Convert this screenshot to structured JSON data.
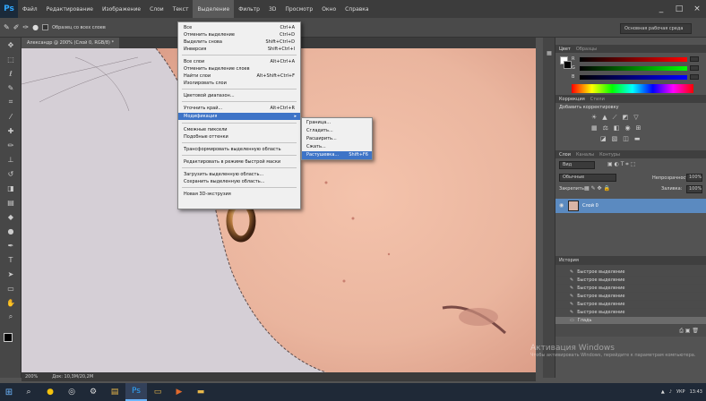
{
  "app": {
    "logo": "Ps",
    "menu": [
      "Файл",
      "Редактирование",
      "Изображение",
      "Слои",
      "Текст",
      "Выделение",
      "Фильтр",
      "3D",
      "Просмотр",
      "Окно",
      "Справка"
    ],
    "active_menu_index": 5
  },
  "window_controls": {
    "minimize": "_",
    "maximize": "□",
    "close": "×"
  },
  "options_bar": {
    "sample_all_layers": "Образец со всех слоев",
    "workspace": "Основная рабочая среда"
  },
  "document": {
    "tab_title": "Александр @ 200% (Слой 0, RGB/8) *",
    "zoom": "200%",
    "doc_size": "Док: 10,3M/20,2M"
  },
  "selection_menu": {
    "items": [
      {
        "label": "Все",
        "shortcut": "Ctrl+A"
      },
      {
        "label": "Отменить выделение",
        "shortcut": "Ctrl+D"
      },
      {
        "label": "Выделить снова",
        "shortcut": "Shift+Ctrl+D"
      },
      {
        "label": "Инверсия",
        "shortcut": "Shift+Ctrl+I"
      },
      {
        "label": "Все слои",
        "shortcut": "Alt+Ctrl+A"
      },
      {
        "label": "Отменить выделение слоев",
        "shortcut": ""
      },
      {
        "label": "Найти слои",
        "shortcut": "Alt+Shift+Ctrl+F"
      },
      {
        "label": "Изолировать слои",
        "shortcut": ""
      },
      {
        "label": "Цветовой диапазон...",
        "shortcut": ""
      },
      {
        "label": "Уточнить край...",
        "shortcut": "Alt+Ctrl+R"
      },
      {
        "label": "Модификация",
        "shortcut": ""
      },
      {
        "label": "Смежные пиксели",
        "shortcut": ""
      },
      {
        "label": "Подобные оттенки",
        "shortcut": ""
      },
      {
        "label": "Трансформировать выделенную область",
        "shortcut": ""
      },
      {
        "label": "Редактировать в режиме быстрой маски",
        "shortcut": ""
      },
      {
        "label": "Загрузить выделенную область...",
        "shortcut": ""
      },
      {
        "label": "Сохранить выделенную область...",
        "shortcut": ""
      },
      {
        "label": "Новая 3D-экструзия",
        "shortcut": ""
      }
    ],
    "submenu_arrow": "▸"
  },
  "modify_submenu": {
    "items": [
      {
        "label": "Граница...",
        "shortcut": ""
      },
      {
        "label": "Сгладить...",
        "shortcut": ""
      },
      {
        "label": "Расширить...",
        "shortcut": ""
      },
      {
        "label": "Сжать...",
        "shortcut": ""
      },
      {
        "label": "Растушевка...",
        "shortcut": "Shift+F6"
      }
    ]
  },
  "color_panel": {
    "tabs": [
      "Цвет",
      "Образцы"
    ],
    "channels": [
      "R",
      "G",
      "B"
    ]
  },
  "adjustments_panel": {
    "tabs": [
      "Коррекция",
      "Стили"
    ],
    "hint": "Добавить корректировку"
  },
  "layers_panel": {
    "tabs": [
      "Слои",
      "Каналы",
      "Контуры"
    ],
    "filter": "Вид",
    "blend_mode": "Обычные",
    "opacity_label": "Непрозрачность:",
    "opacity": "100%",
    "lock_label": "Закрепить:",
    "fill_label": "Заливка:",
    "fill": "100%",
    "layer_name": "Слой 0"
  },
  "history_panel": {
    "title": "История",
    "items": [
      "Быстрое выделение",
      "Быстрое выделение",
      "Быстрое выделение",
      "Быстрое выделение",
      "Быстрое выделение",
      "Быстрое выделение",
      "Гладь"
    ]
  },
  "watermark": {
    "title": "Активация Windows",
    "subtitle": "Чтобы активировать Windows, перейдите к параметрам компьютера."
  },
  "taskbar": {
    "lang": "УКР",
    "time": "13:43"
  },
  "colors": {
    "accent": "#3e74c7",
    "menubar": "#3c3c3c",
    "panel": "#535353"
  }
}
